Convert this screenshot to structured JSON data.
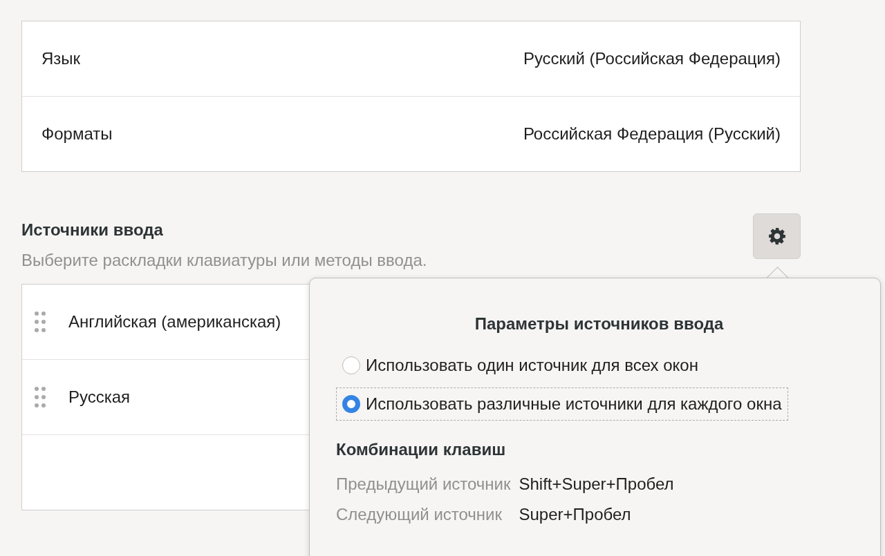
{
  "region": [
    {
      "label": "Язык",
      "value": "Русский (Российская Федерация)"
    },
    {
      "label": "Форматы",
      "value": "Российская Федерация (Русский)"
    }
  ],
  "input_sources": {
    "title": "Источники ввода",
    "subtitle": "Выберите раскладки клавиатуры или методы ввода.",
    "items": [
      {
        "name": "Английская (американская)"
      },
      {
        "name": "Русская"
      }
    ]
  },
  "popover": {
    "title": "Параметры источников ввода",
    "options": [
      {
        "label": "Использовать один источник для всех окон",
        "selected": false
      },
      {
        "label": "Использовать различные источники для каждого окна",
        "selected": true
      }
    ],
    "shortcuts_title": "Комбинации клавиш",
    "shortcuts": [
      {
        "label": "Предыдущий источник",
        "keys": "Shift+Super+Пробел"
      },
      {
        "label": "Следующий источник",
        "keys": "Super+Пробел"
      }
    ]
  }
}
